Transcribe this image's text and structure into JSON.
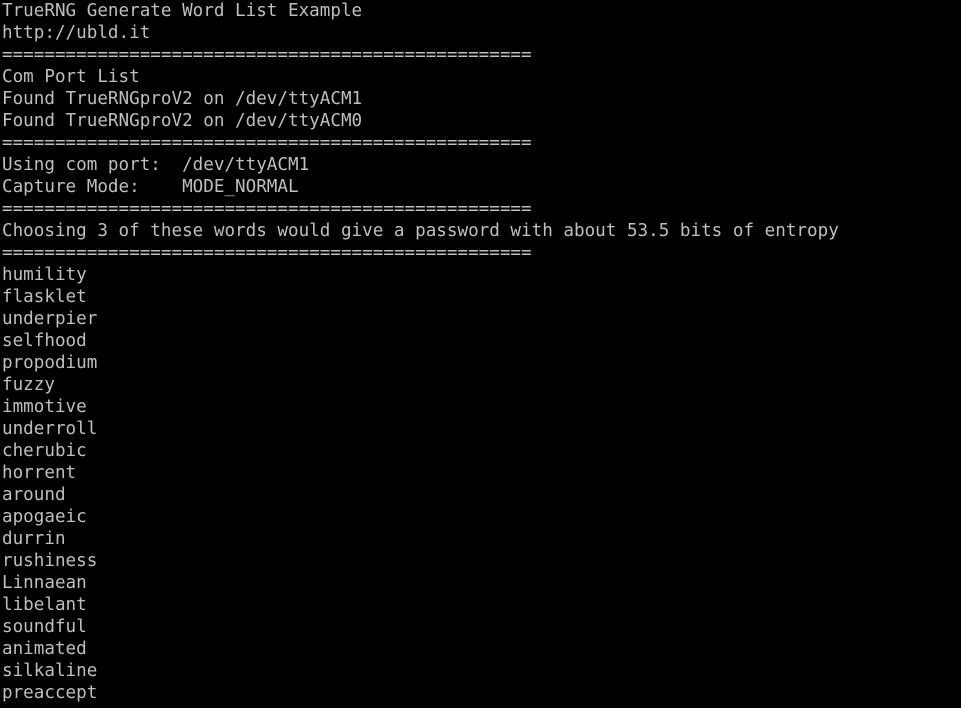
{
  "terminal": {
    "background_color": "#000000",
    "text_color": "#bfbfbf",
    "title": "TrueRNG Generate Word List Example",
    "url": "http://ubld.it",
    "separator": "==================================================",
    "com_port_list_header": "Com Port List",
    "found_devices": [
      "Found TrueRNGproV2 on /dev/ttyACM1",
      "Found TrueRNGproV2 on /dev/ttyACM0"
    ],
    "using_com_port": "Using com port:  /dev/ttyACM1",
    "capture_mode": "Capture Mode:    MODE_NORMAL",
    "entropy_message": "Choosing 3 of these words would give a password with about 53.5 bits of entropy",
    "words": [
      "humility",
      "flasklet",
      "underpier",
      "selfhood",
      "propodium",
      "fuzzy",
      "immotive",
      "underroll",
      "cherubic",
      "horrent",
      "around",
      "apogaeic",
      "durrin",
      "rushiness",
      "Linnaean",
      "libelant",
      "soundful",
      "animated",
      "silkaline",
      "preaccept"
    ]
  }
}
